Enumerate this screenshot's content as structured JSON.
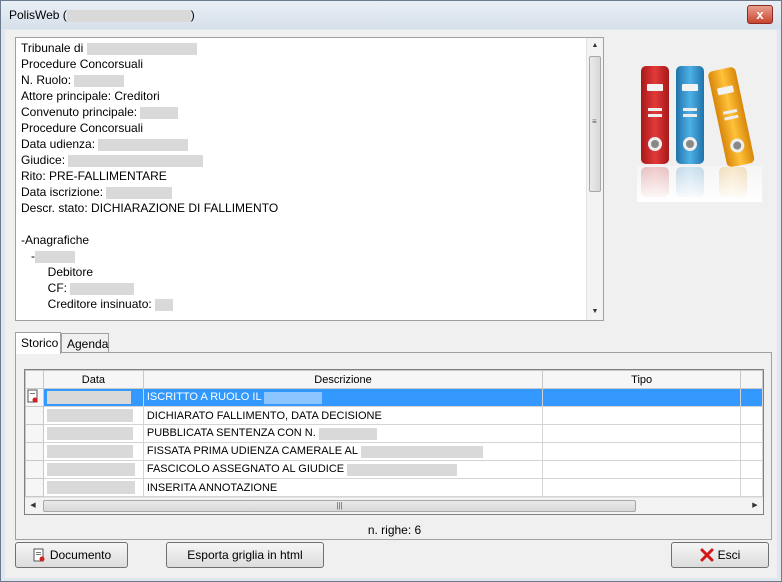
{
  "window": {
    "title": "PolisWeb (",
    "title_close": ")",
    "close_glyph": "x"
  },
  "memo": {
    "lines": [
      {
        "label": "Tribunale di ",
        "redact": 110
      },
      {
        "label": "Procedure Concorsuali"
      },
      {
        "label": "N. Ruolo: ",
        "redact": 50
      },
      {
        "label": "Attore principale: Creditori"
      },
      {
        "label": "Convenuto principale: ",
        "redact": 38
      },
      {
        "label": "Procedure Concorsuali"
      },
      {
        "label": "Data udienza: ",
        "redact": 90
      },
      {
        "label": "Giudice: ",
        "redact": 135
      },
      {
        "label": "Rito: PRE-FALLIMENTARE"
      },
      {
        "label": "Data iscrizione: ",
        "redact": 66
      },
      {
        "label": "Descr. stato: DICHIARAZIONE DI FALLIMENTO"
      },
      {
        "label": ""
      },
      {
        "label": "-Anagrafiche"
      },
      {
        "label": "   -",
        "redact": 40
      },
      {
        "label": "        Debitore"
      },
      {
        "label": "        CF: ",
        "redact": 64
      },
      {
        "label": "        Creditore insinuato: ",
        "redact": 18
      }
    ]
  },
  "tabs": [
    {
      "label": "Storico",
      "active": true
    },
    {
      "label": "Agenda",
      "active": false
    }
  ],
  "grid": {
    "columns": [
      "Data",
      "Descrizione",
      "Tipo"
    ],
    "rows": [
      {
        "data_redact": 84,
        "descrizione": "ISCRITTO A RUOLO IL ",
        "desc_redact": 58,
        "tipo": "",
        "selected": true
      },
      {
        "data_redact": 86,
        "descrizione": "DICHIARATO FALLIMENTO, DATA DECISIONE",
        "desc_redact": 0,
        "tipo": ""
      },
      {
        "data_redact": 86,
        "descrizione": "PUBBLICATA SENTENZA CON N. ",
        "desc_redact": 58,
        "tipo": ""
      },
      {
        "data_redact": 86,
        "descrizione": "FISSATA PRIMA UDIENZA CAMERALE AL ",
        "desc_redact": 122,
        "tipo": ""
      },
      {
        "data_redact": 88,
        "descrizione": "FASCICOLO ASSEGNATO AL GIUDICE ",
        "desc_redact": 110,
        "tipo": ""
      },
      {
        "data_redact": 88,
        "descrizione": "INSERITA ANNOTAZIONE",
        "desc_redact": 0,
        "tipo": ""
      }
    ],
    "row_count_label": "n. righe: 6"
  },
  "buttons": {
    "documento": "Documento",
    "esporta": "Esporta griglia in html",
    "esci": "Esci"
  },
  "colors": {
    "selection": "#3399ff",
    "binder_red": "#d42a2a",
    "binder_blue": "#3a9bd6",
    "binder_yellow": "#f0a818"
  }
}
